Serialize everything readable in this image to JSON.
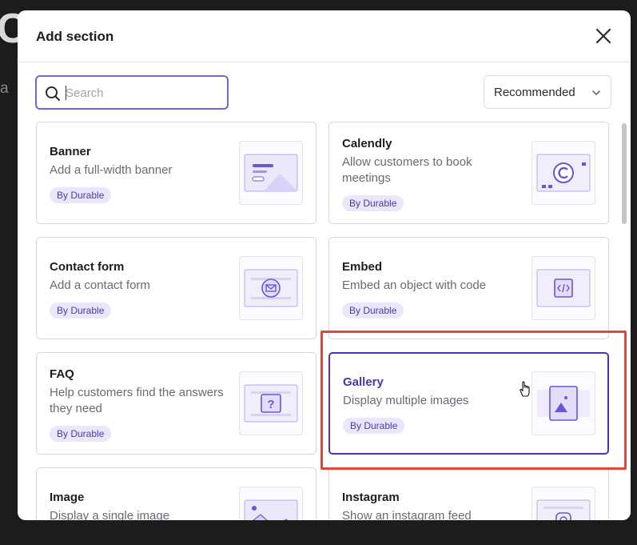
{
  "modal": {
    "title": "Add section"
  },
  "search": {
    "placeholder": "Search",
    "value": ""
  },
  "sort": {
    "selected": "Recommended"
  },
  "cards": [
    {
      "title": "Banner",
      "description": "Add a full-width banner",
      "badge": "By Durable",
      "icon": "banner-thumbnail-icon"
    },
    {
      "title": "Calendly",
      "description": "Allow customers to book meetings",
      "badge": "By Durable",
      "icon": "calendly-thumbnail-icon"
    },
    {
      "title": "Contact form",
      "description": "Add a contact form",
      "badge": "By Durable",
      "icon": "contact-form-thumbnail-icon"
    },
    {
      "title": "Embed",
      "description": "Embed an object with code",
      "badge": "By Durable",
      "icon": "embed-thumbnail-icon"
    },
    {
      "title": "FAQ",
      "description": "Help customers find the answers they need",
      "badge": "By Durable",
      "icon": "faq-thumbnail-icon"
    },
    {
      "title": "Gallery",
      "description": "Display multiple images",
      "badge": "By Durable",
      "icon": "gallery-thumbnail-icon",
      "selected": true
    },
    {
      "title": "Image",
      "description": "Display a single image",
      "badge": "",
      "icon": "image-thumbnail-icon"
    },
    {
      "title": "Instagram",
      "description": "Show an instagram feed",
      "badge": "",
      "icon": "instagram-thumbnail-icon"
    }
  ],
  "colors": {
    "accent": "#4b34b8",
    "badge_bg": "#ebe6fb",
    "highlight": "#e0463a"
  }
}
